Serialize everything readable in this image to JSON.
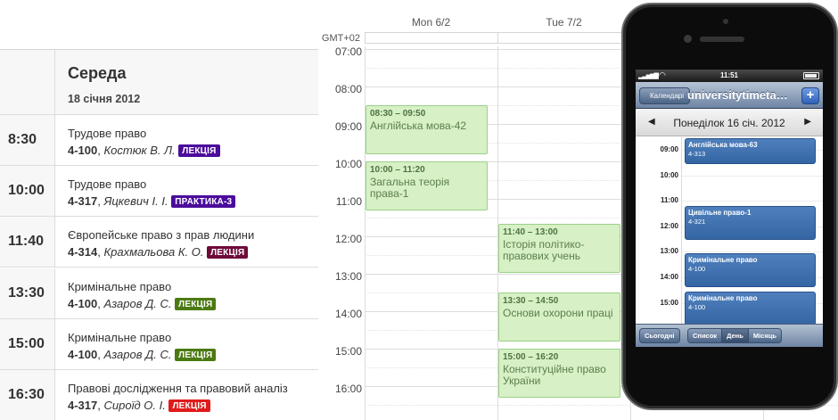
{
  "colors": {
    "badge_lecture_purple": "#4b0c9c",
    "badge_practice": "#4b0c9c",
    "badge_lecture_maroon": "#6e0b3a",
    "badge_lecture_green": "#4c7a12",
    "badge_lecture_red": "#e01b1b",
    "event_green": "#d7f0c5",
    "ios_event_blue": "#3f70ae"
  },
  "schedule": {
    "day_name": "Середа",
    "date": "18 січня 2012",
    "lessons": [
      {
        "time": "8:30",
        "title": "Трудове право",
        "room": "4-100",
        "teacher": "Костюк В. Л.",
        "badge": "ЛЕКЦІЯ",
        "badge_color": "#4b0c9c"
      },
      {
        "time": "10:00",
        "title": "Трудове право",
        "room": "4-317",
        "teacher": "Яцкевич І. І.",
        "badge": "ПРАКТИКА-3",
        "badge_color": "#4b0c9c"
      },
      {
        "time": "11:40",
        "title": "Європейське право з прав людини",
        "room": "4-314",
        "teacher": "Крахмальова К. О.",
        "badge": "ЛЕКЦІЯ",
        "badge_color": "#6e0b3a"
      },
      {
        "time": "13:30",
        "title": "Кримінальне право",
        "room": "4-100",
        "teacher": "Азаров Д. С.",
        "badge": "ЛЕКЦІЯ",
        "badge_color": "#4c7a12"
      },
      {
        "time": "15:00",
        "title": "Кримінальне право",
        "room": "4-100",
        "teacher": "Азаров Д. С.",
        "badge": "ЛЕКЦІЯ",
        "badge_color": "#4c7a12"
      },
      {
        "time": "16:30",
        "title": "Правові дослідження та правовий аналіз",
        "room": "4-317",
        "teacher": "Сироїд О. І.",
        "badge": "ЛЕКЦІЯ",
        "badge_color": "#e01b1b"
      }
    ]
  },
  "week": {
    "timezone_label": "GMT+02",
    "columns": [
      "Mon 6/2",
      "Tue 7/2"
    ],
    "hours": [
      "07:00",
      "08:00",
      "09:00",
      "10:00",
      "11:00",
      "12:00",
      "13:00",
      "14:00",
      "15:00",
      "16:00"
    ],
    "events": [
      {
        "day": 0,
        "start": 8.5,
        "end": 9.8333,
        "time_label": "08:30 – 09:50",
        "title": "Англійська мова-42"
      },
      {
        "day": 0,
        "start": 10.0,
        "end": 11.3333,
        "time_label": "10:00 – 11:20",
        "title": "Загальна теорія права-1"
      },
      {
        "day": 1,
        "start": 11.6667,
        "end": 13.0,
        "time_label": "11:40 – 13:00",
        "title": "Історія політико-правових учень"
      },
      {
        "day": 1,
        "start": 13.5,
        "end": 14.8333,
        "time_label": "13:30 – 14:50",
        "title": "Основи охорони праці"
      },
      {
        "day": 1,
        "start": 15.0,
        "end": 16.3333,
        "time_label": "15:00 – 16:20",
        "title": "Конституційне право України"
      }
    ]
  },
  "phone": {
    "status_time": "11:51",
    "status_icons": [
      "signal-icon",
      "wifi-icon",
      "battery-icon"
    ],
    "back_label": "Календарі",
    "nav_title": "universitytimeta…",
    "add_label": "+",
    "day_title": "Понеділок  16 січ. 2012",
    "hours": [
      "09:00",
      "10:00",
      "11:00",
      "12:00",
      "13:00",
      "14:00",
      "15:00"
    ],
    "events": [
      {
        "start": 9.0,
        "end": 10.0,
        "title": "Англійська мова-63",
        "room": "4-313"
      },
      {
        "start": 11.6667,
        "end": 13.0,
        "title": "Цивільне право-1",
        "room": "4-321"
      },
      {
        "start": 13.5,
        "end": 14.8333,
        "title": "Кримінальне право",
        "room": "4-100"
      },
      {
        "start": 15.0,
        "end": 16.3333,
        "title": "Кримінальне право",
        "room": "4-100"
      }
    ],
    "today_label": "Сьогодні",
    "segments": [
      "Список",
      "День",
      "Місяць"
    ],
    "active_segment": "День"
  }
}
